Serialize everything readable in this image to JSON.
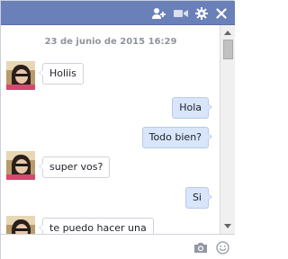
{
  "header": {
    "icons": [
      "add-people-icon",
      "video-call-icon",
      "gear-icon",
      "close-icon"
    ],
    "background": "#6a80b8"
  },
  "conversation": {
    "timestamp": "23 de junio de 2015 16:29",
    "messages": [
      {
        "from": "them",
        "text": "Holiis"
      },
      {
        "from": "me",
        "text": "Hola"
      },
      {
        "from": "me",
        "text": "Todo bien?"
      },
      {
        "from": "them",
        "text": "super vos?"
      },
      {
        "from": "me",
        "text": "Si"
      },
      {
        "from": "them",
        "text": "te puedo hacer una"
      }
    ]
  },
  "composer": {
    "input_value": "",
    "placeholder": "",
    "icons": [
      "camera-icon",
      "emoji-icon"
    ]
  },
  "colors": {
    "outgoing_bubble": "#d8e5fa",
    "incoming_bubble": "#ffffff"
  }
}
